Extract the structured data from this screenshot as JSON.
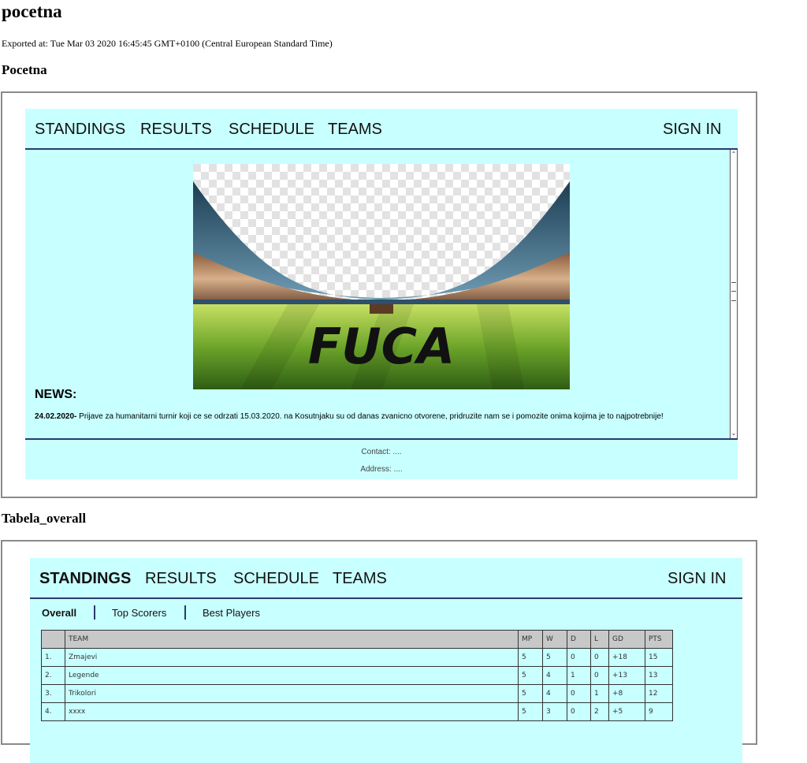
{
  "document": {
    "title": "pocetna",
    "exported": "Exported at: Tue Mar 03 2020 16:45:45 GMT+0100 (Central European Standard Time)"
  },
  "sections": {
    "home_title": "Pocetna",
    "table_title": "Tabela_overall"
  },
  "nav": {
    "standings": "STANDINGS",
    "results": "RESULTS",
    "schedule": "SCHEDULE",
    "teams": "TEAMS",
    "sign_in": "SIGN IN"
  },
  "hero": {
    "logo_text": "FUCA"
  },
  "news": {
    "heading": "NEWS:",
    "date": "24.02.2020-",
    "text": "Prijave za humanitarni turnir koji ce se odrzati 15.03.2020. na Kosutnjaku su od danas zvanicno otvorene, pridruzite nam se i pomozite onima kojima je to najpotrebnije!"
  },
  "footer": {
    "contact": "Contact: ....",
    "address": "Address: ...."
  },
  "subnav": {
    "overall": "Overall",
    "top_scorers": "Top Scorers",
    "best_players": "Best Players"
  },
  "table": {
    "headers": [
      "",
      "TEAM",
      "MP",
      "W",
      "D",
      "L",
      "GD",
      "PTS"
    ],
    "rows": [
      [
        "1.",
        "Zmajevi",
        "5",
        "5",
        "0",
        "0",
        "+18",
        "15"
      ],
      [
        "2.",
        "Legende",
        "5",
        "4",
        "1",
        "0",
        "+13",
        "13"
      ],
      [
        "3.",
        "Trikolori",
        "5",
        "4",
        "0",
        "1",
        "+8",
        "12"
      ],
      [
        "4.",
        "xxxx",
        "5",
        "3",
        "0",
        "2",
        "+5",
        "9"
      ]
    ]
  },
  "colors": {
    "app_background": "#c8ffff",
    "nav_rule": "#2b3a6b",
    "table_header": "#c8c8c8"
  }
}
